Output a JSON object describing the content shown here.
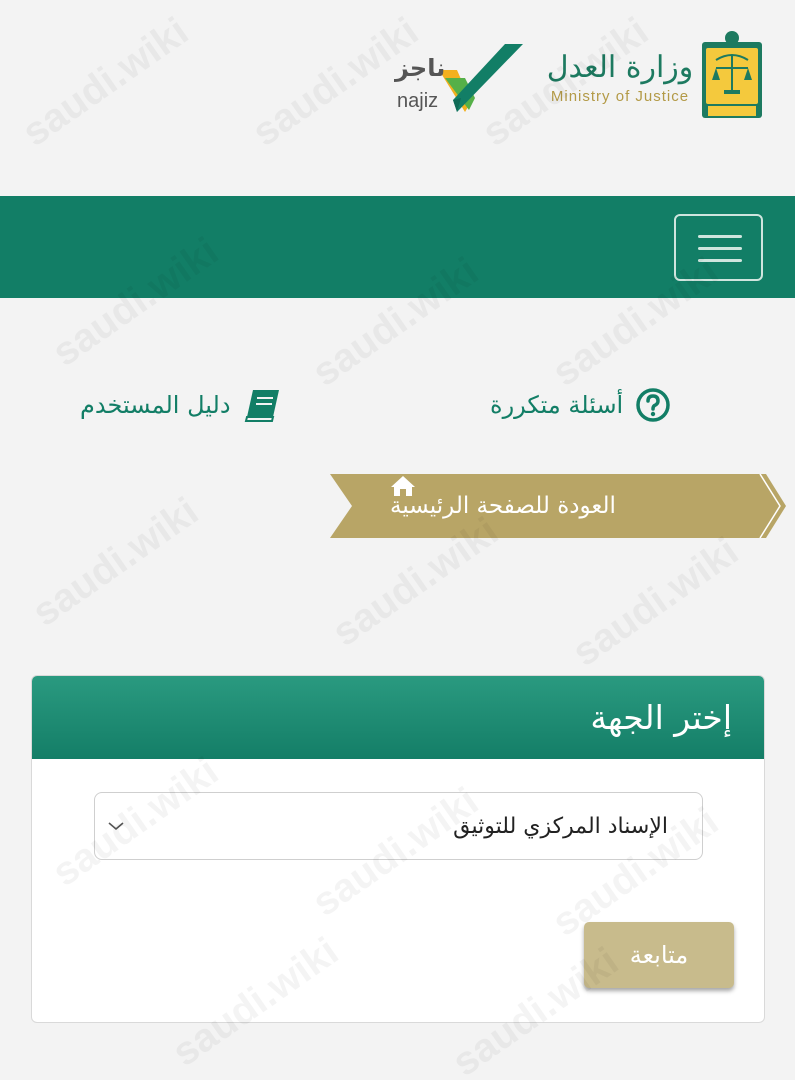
{
  "header": {
    "ministry_arabic": "وزارة العدل",
    "ministry_english": "Ministry of Justice",
    "najiz_arabic": "ناجز",
    "najiz_latin": "najiz",
    "colors": {
      "green": "#127e66",
      "gold": "#b39a47"
    }
  },
  "navbar": {
    "menu_icon": "hamburger-icon"
  },
  "links": {
    "faq": "أسئلة متكررة",
    "faq_icon": "question-circle-icon",
    "user_guide": "دليل المستخدم",
    "user_guide_icon": "book-icon"
  },
  "back_link": {
    "label": "العودة للصفحة الرئيسية",
    "icon": "home-icon"
  },
  "card": {
    "title": "إختر الجهة",
    "select_value": "الإسناد المركزي للتوثيق",
    "continue_label": "متابعة"
  },
  "watermark": "saudi.wiki"
}
